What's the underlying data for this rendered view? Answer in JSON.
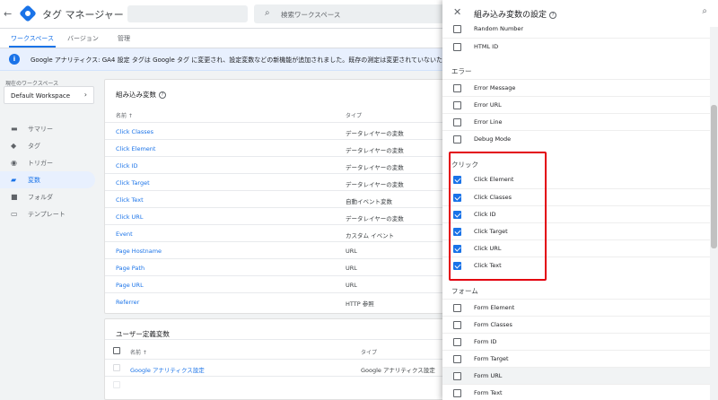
{
  "app": {
    "back_icon": "arrow-left-icon",
    "title": "タグ マネージャー"
  },
  "search": {
    "placeholder": "検索ワークスペース"
  },
  "tabs": [
    {
      "label": "ワークスペース",
      "active": true
    },
    {
      "label": "バージョン",
      "active": false
    },
    {
      "label": "管理",
      "active": false
    }
  ],
  "banner": {
    "text": "Google アナリティクス: GA4 設定 タグは Google タグ に変更され、設定変数などの新機能が追加されました。既存の測定は変更されていないため、特に"
  },
  "sidebar": {
    "workspace_label": "現在のワークスペース",
    "workspace_name": "Default Workspace",
    "items": [
      {
        "label": "サマリー",
        "icon": "summary-icon",
        "active": false
      },
      {
        "label": "タグ",
        "icon": "tag-icon",
        "active": false
      },
      {
        "label": "トリガー",
        "icon": "trigger-icon",
        "active": false
      },
      {
        "label": "変数",
        "icon": "variable-icon",
        "active": true
      },
      {
        "label": "フォルダ",
        "icon": "folder-icon",
        "active": false
      },
      {
        "label": "テンプレート",
        "icon": "template-icon",
        "active": false
      }
    ]
  },
  "builtin_card": {
    "title": "組み込み変数",
    "col_name": "名前 ↑",
    "col_type": "タイプ",
    "rows": [
      {
        "name": "Click Classes",
        "type": "データレイヤーの変数"
      },
      {
        "name": "Click Element",
        "type": "データレイヤーの変数"
      },
      {
        "name": "Click ID",
        "type": "データレイヤーの変数"
      },
      {
        "name": "Click Target",
        "type": "データレイヤーの変数"
      },
      {
        "name": "Click Text",
        "type": "自動イベント変数"
      },
      {
        "name": "Click URL",
        "type": "データレイヤーの変数"
      },
      {
        "name": "Event",
        "type": "カスタム イベント"
      },
      {
        "name": "Page Hostname",
        "type": "URL"
      },
      {
        "name": "Page Path",
        "type": "URL"
      },
      {
        "name": "Page URL",
        "type": "URL"
      },
      {
        "name": "Referrer",
        "type": "HTTP 参照"
      }
    ]
  },
  "user_card": {
    "title": "ユーザー定義変数",
    "col_name": "名前 ↑",
    "col_type": "タイプ",
    "rows": [
      {
        "name": "Google アナリティクス設定",
        "type": "Google アナリティクス設定"
      }
    ]
  },
  "panel": {
    "title": "組み込み変数の設定",
    "top_options": [
      {
        "label": "Random Number",
        "checked": false
      },
      {
        "label": "HTML ID",
        "checked": false
      }
    ],
    "sections": [
      {
        "heading": "エラー",
        "options": [
          {
            "label": "Error Message",
            "checked": false
          },
          {
            "label": "Error URL",
            "checked": false
          },
          {
            "label": "Error Line",
            "checked": false
          },
          {
            "label": "Debug Mode",
            "checked": false
          }
        ]
      },
      {
        "heading": "クリック",
        "options": [
          {
            "label": "Click Element",
            "checked": true
          },
          {
            "label": "Click Classes",
            "checked": true
          },
          {
            "label": "Click ID",
            "checked": true
          },
          {
            "label": "Click Target",
            "checked": true
          },
          {
            "label": "Click URL",
            "checked": true
          },
          {
            "label": "Click Text",
            "checked": true
          }
        ]
      },
      {
        "heading": "フォーム",
        "options": [
          {
            "label": "Form Element",
            "checked": false
          },
          {
            "label": "Form Classes",
            "checked": false
          },
          {
            "label": "Form ID",
            "checked": false
          },
          {
            "label": "Form Target",
            "checked": false
          },
          {
            "label": "Form URL",
            "checked": false
          },
          {
            "label": "Form Text",
            "checked": false
          }
        ]
      }
    ]
  },
  "colors": {
    "accent": "#1a73e8",
    "highlight": "#e3000f"
  }
}
